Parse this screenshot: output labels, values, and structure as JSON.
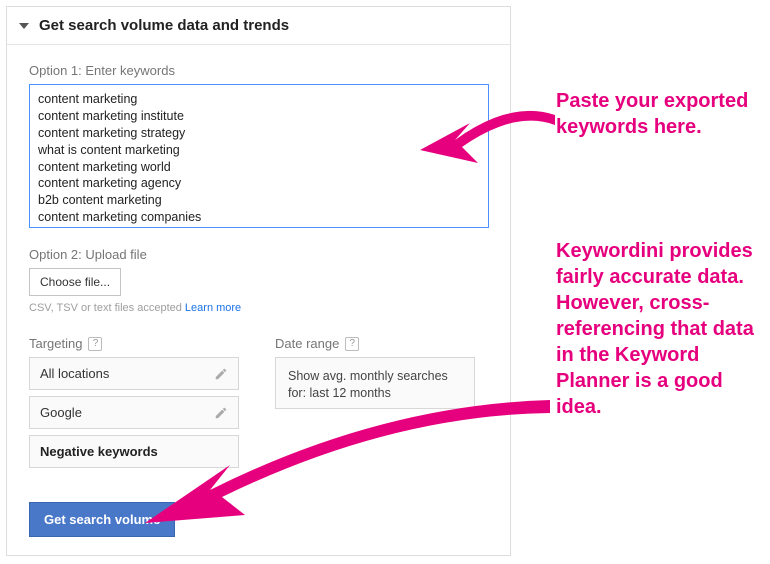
{
  "header": {
    "title": "Get search volume data and trends"
  },
  "option1": {
    "label": "Option 1: Enter keywords",
    "value": "content marketing\ncontent marketing institute\ncontent marketing strategy\nwhat is content marketing\ncontent marketing world\ncontent marketing agency\nb2b content marketing\ncontent marketing companies"
  },
  "option2": {
    "label": "Option 2: Upload file",
    "button": "Choose file...",
    "hint": "CSV, TSV or text files accepted ",
    "learn_more": "Learn more"
  },
  "targeting": {
    "title": "Targeting",
    "items": [
      "All locations",
      "Google",
      "Negative keywords"
    ]
  },
  "daterange": {
    "title": "Date range",
    "text": "Show avg. monthly searches for: last 12 months"
  },
  "submit": {
    "label": "Get search volume"
  },
  "annotations": {
    "a1": "Paste your exported keywords here.",
    "a2": "Keywordini provides fairly accurate data. However, cross-referencing that data in the Keyword Planner is a good idea."
  }
}
